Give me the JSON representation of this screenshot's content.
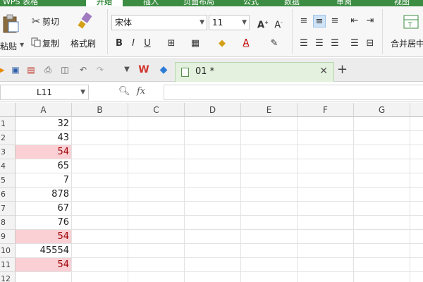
{
  "menubar": {
    "app_title": "WPS 表格",
    "tabs": [
      {
        "label": "开始",
        "active": true
      },
      {
        "label": "插入",
        "active": false
      },
      {
        "label": "页面布局",
        "active": false
      },
      {
        "label": "公式",
        "active": false
      },
      {
        "label": "数据",
        "active": false
      },
      {
        "label": "审阅",
        "active": false
      },
      {
        "label": "视图",
        "active": false
      }
    ]
  },
  "ribbon": {
    "paste": "粘贴",
    "cut": "剪切",
    "copy": "复制",
    "format_painter": "格式刷",
    "font_name": "宋体",
    "font_size": "11",
    "merge_center": "合并居中"
  },
  "doc_tab": {
    "name": "01 *"
  },
  "formula_bar": {
    "name_box": "L11",
    "fx": "fx"
  },
  "columns": [
    "A",
    "B",
    "C",
    "D",
    "E",
    "F",
    "G"
  ],
  "rows": [
    {
      "num": "1",
      "value": "32",
      "duplicate": false
    },
    {
      "num": "2",
      "value": "43",
      "duplicate": false
    },
    {
      "num": "3",
      "value": "54",
      "duplicate": true
    },
    {
      "num": "4",
      "value": "65",
      "duplicate": false
    },
    {
      "num": "5",
      "value": "7",
      "duplicate": false
    },
    {
      "num": "6",
      "value": "878",
      "duplicate": false
    },
    {
      "num": "7",
      "value": "67",
      "duplicate": false
    },
    {
      "num": "8",
      "value": "76",
      "duplicate": false
    },
    {
      "num": "9",
      "value": "54",
      "duplicate": true
    },
    {
      "num": "10",
      "value": "45554",
      "duplicate": false
    },
    {
      "num": "11",
      "value": "54",
      "duplicate": true
    },
    {
      "num": "12",
      "value": "",
      "duplicate": false
    }
  ],
  "colors": {
    "accent": "#3c8d43",
    "duplicate_fill": "#fbd0d4",
    "duplicate_text": "#9c0006"
  }
}
